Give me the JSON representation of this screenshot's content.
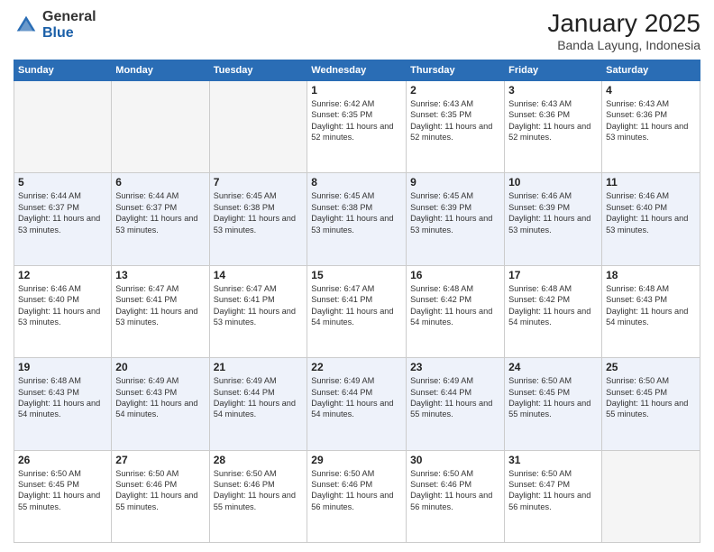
{
  "logo": {
    "general": "General",
    "blue": "Blue"
  },
  "header": {
    "month": "January 2025",
    "location": "Banda Layung, Indonesia"
  },
  "weekdays": [
    "Sunday",
    "Monday",
    "Tuesday",
    "Wednesday",
    "Thursday",
    "Friday",
    "Saturday"
  ],
  "weeks": [
    [
      {
        "day": "",
        "sunrise": "",
        "sunset": "",
        "daylight": ""
      },
      {
        "day": "",
        "sunrise": "",
        "sunset": "",
        "daylight": ""
      },
      {
        "day": "",
        "sunrise": "",
        "sunset": "",
        "daylight": ""
      },
      {
        "day": "1",
        "sunrise": "Sunrise: 6:42 AM",
        "sunset": "Sunset: 6:35 PM",
        "daylight": "Daylight: 11 hours and 52 minutes."
      },
      {
        "day": "2",
        "sunrise": "Sunrise: 6:43 AM",
        "sunset": "Sunset: 6:35 PM",
        "daylight": "Daylight: 11 hours and 52 minutes."
      },
      {
        "day": "3",
        "sunrise": "Sunrise: 6:43 AM",
        "sunset": "Sunset: 6:36 PM",
        "daylight": "Daylight: 11 hours and 52 minutes."
      },
      {
        "day": "4",
        "sunrise": "Sunrise: 6:43 AM",
        "sunset": "Sunset: 6:36 PM",
        "daylight": "Daylight: 11 hours and 53 minutes."
      }
    ],
    [
      {
        "day": "5",
        "sunrise": "Sunrise: 6:44 AM",
        "sunset": "Sunset: 6:37 PM",
        "daylight": "Daylight: 11 hours and 53 minutes."
      },
      {
        "day": "6",
        "sunrise": "Sunrise: 6:44 AM",
        "sunset": "Sunset: 6:37 PM",
        "daylight": "Daylight: 11 hours and 53 minutes."
      },
      {
        "day": "7",
        "sunrise": "Sunrise: 6:45 AM",
        "sunset": "Sunset: 6:38 PM",
        "daylight": "Daylight: 11 hours and 53 minutes."
      },
      {
        "day": "8",
        "sunrise": "Sunrise: 6:45 AM",
        "sunset": "Sunset: 6:38 PM",
        "daylight": "Daylight: 11 hours and 53 minutes."
      },
      {
        "day": "9",
        "sunrise": "Sunrise: 6:45 AM",
        "sunset": "Sunset: 6:39 PM",
        "daylight": "Daylight: 11 hours and 53 minutes."
      },
      {
        "day": "10",
        "sunrise": "Sunrise: 6:46 AM",
        "sunset": "Sunset: 6:39 PM",
        "daylight": "Daylight: 11 hours and 53 minutes."
      },
      {
        "day": "11",
        "sunrise": "Sunrise: 6:46 AM",
        "sunset": "Sunset: 6:40 PM",
        "daylight": "Daylight: 11 hours and 53 minutes."
      }
    ],
    [
      {
        "day": "12",
        "sunrise": "Sunrise: 6:46 AM",
        "sunset": "Sunset: 6:40 PM",
        "daylight": "Daylight: 11 hours and 53 minutes."
      },
      {
        "day": "13",
        "sunrise": "Sunrise: 6:47 AM",
        "sunset": "Sunset: 6:41 PM",
        "daylight": "Daylight: 11 hours and 53 minutes."
      },
      {
        "day": "14",
        "sunrise": "Sunrise: 6:47 AM",
        "sunset": "Sunset: 6:41 PM",
        "daylight": "Daylight: 11 hours and 53 minutes."
      },
      {
        "day": "15",
        "sunrise": "Sunrise: 6:47 AM",
        "sunset": "Sunset: 6:41 PM",
        "daylight": "Daylight: 11 hours and 54 minutes."
      },
      {
        "day": "16",
        "sunrise": "Sunrise: 6:48 AM",
        "sunset": "Sunset: 6:42 PM",
        "daylight": "Daylight: 11 hours and 54 minutes."
      },
      {
        "day": "17",
        "sunrise": "Sunrise: 6:48 AM",
        "sunset": "Sunset: 6:42 PM",
        "daylight": "Daylight: 11 hours and 54 minutes."
      },
      {
        "day": "18",
        "sunrise": "Sunrise: 6:48 AM",
        "sunset": "Sunset: 6:43 PM",
        "daylight": "Daylight: 11 hours and 54 minutes."
      }
    ],
    [
      {
        "day": "19",
        "sunrise": "Sunrise: 6:48 AM",
        "sunset": "Sunset: 6:43 PM",
        "daylight": "Daylight: 11 hours and 54 minutes."
      },
      {
        "day": "20",
        "sunrise": "Sunrise: 6:49 AM",
        "sunset": "Sunset: 6:43 PM",
        "daylight": "Daylight: 11 hours and 54 minutes."
      },
      {
        "day": "21",
        "sunrise": "Sunrise: 6:49 AM",
        "sunset": "Sunset: 6:44 PM",
        "daylight": "Daylight: 11 hours and 54 minutes."
      },
      {
        "day": "22",
        "sunrise": "Sunrise: 6:49 AM",
        "sunset": "Sunset: 6:44 PM",
        "daylight": "Daylight: 11 hours and 54 minutes."
      },
      {
        "day": "23",
        "sunrise": "Sunrise: 6:49 AM",
        "sunset": "Sunset: 6:44 PM",
        "daylight": "Daylight: 11 hours and 55 minutes."
      },
      {
        "day": "24",
        "sunrise": "Sunrise: 6:50 AM",
        "sunset": "Sunset: 6:45 PM",
        "daylight": "Daylight: 11 hours and 55 minutes."
      },
      {
        "day": "25",
        "sunrise": "Sunrise: 6:50 AM",
        "sunset": "Sunset: 6:45 PM",
        "daylight": "Daylight: 11 hours and 55 minutes."
      }
    ],
    [
      {
        "day": "26",
        "sunrise": "Sunrise: 6:50 AM",
        "sunset": "Sunset: 6:45 PM",
        "daylight": "Daylight: 11 hours and 55 minutes."
      },
      {
        "day": "27",
        "sunrise": "Sunrise: 6:50 AM",
        "sunset": "Sunset: 6:46 PM",
        "daylight": "Daylight: 11 hours and 55 minutes."
      },
      {
        "day": "28",
        "sunrise": "Sunrise: 6:50 AM",
        "sunset": "Sunset: 6:46 PM",
        "daylight": "Daylight: 11 hours and 55 minutes."
      },
      {
        "day": "29",
        "sunrise": "Sunrise: 6:50 AM",
        "sunset": "Sunset: 6:46 PM",
        "daylight": "Daylight: 11 hours and 56 minutes."
      },
      {
        "day": "30",
        "sunrise": "Sunrise: 6:50 AM",
        "sunset": "Sunset: 6:46 PM",
        "daylight": "Daylight: 11 hours and 56 minutes."
      },
      {
        "day": "31",
        "sunrise": "Sunrise: 6:50 AM",
        "sunset": "Sunset: 6:47 PM",
        "daylight": "Daylight: 11 hours and 56 minutes."
      },
      {
        "day": "",
        "sunrise": "",
        "sunset": "",
        "daylight": ""
      }
    ]
  ]
}
